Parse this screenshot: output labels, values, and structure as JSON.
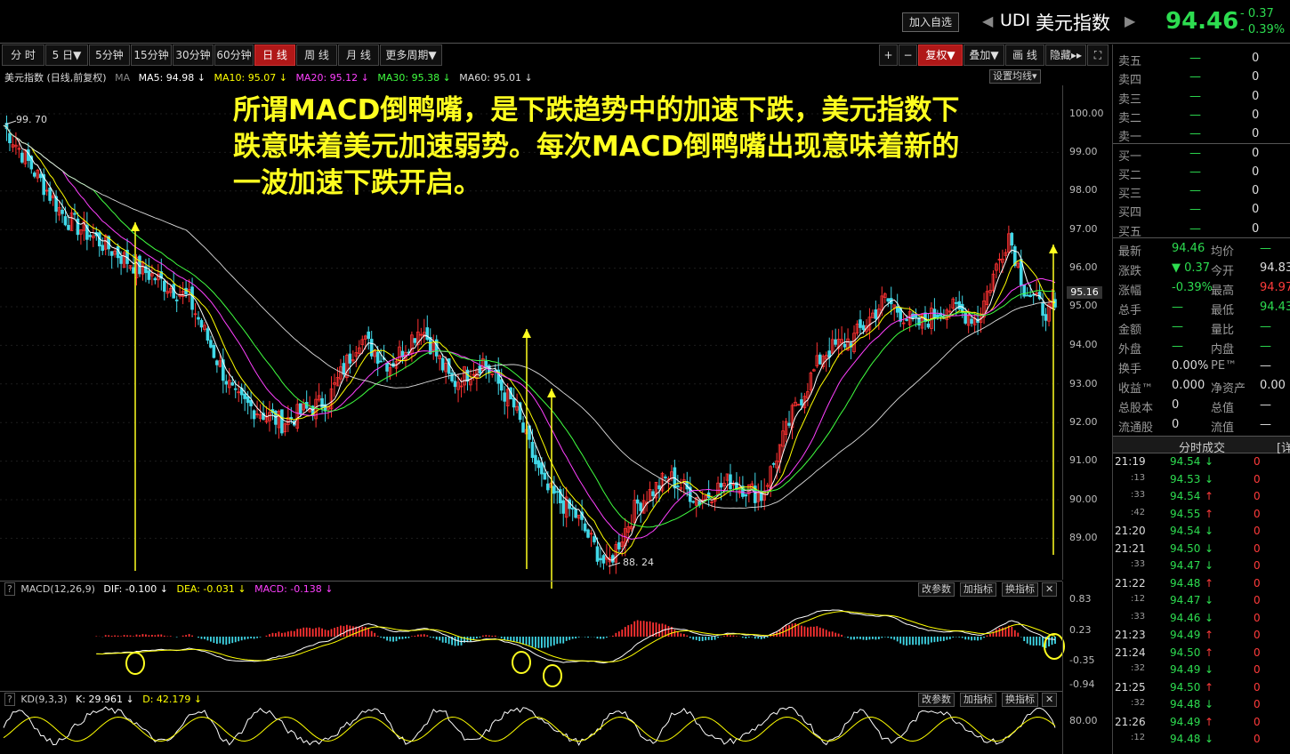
{
  "toolbar": {
    "add_watch": "加入自选",
    "code": "UDI",
    "name": "美元指数",
    "price": "94.46",
    "change": "- 0.37",
    "change_pct": "- 0.39%"
  },
  "tabs": [
    "分 时",
    "5 日▼",
    "5分钟",
    "15分钟",
    "30分钟",
    "60分钟",
    "日 线",
    "周 线",
    "月 线",
    "更多周期▼"
  ],
  "active_tab": "日 线",
  "right_tools": {
    "plus": "+",
    "minus": "−",
    "fuquan": "复权▼",
    "diejia": "叠加▼",
    "huaxian": "画 线",
    "yincang": "隐藏▸▸",
    "expand": "⛶"
  },
  "ma_header": {
    "title": "美元指数 (日线,前复权)",
    "ma_label": "MA",
    "ma5": "MA5: 94.98 ↓",
    "ma10": "MA10: 95.07 ↓",
    "ma20": "MA20: 95.12 ↓",
    "ma30": "MA30: 95.38 ↓",
    "ma60": "MA60: 95.01 ↓",
    "settings": "设置均线▾"
  },
  "price_axis": [
    "100.00",
    "99.00",
    "98.00",
    "97.00",
    "96.00",
    "95.00",
    "94.00",
    "93.00",
    "92.00",
    "91.00",
    "90.00",
    "89.00"
  ],
  "price_marker": "95.16",
  "extremes": {
    "high_label": "99. 70",
    "low_label": "88. 24"
  },
  "annotation": "所谓MACD倒鸭嘴，是下跌趋势中的加速下跌，美元指数下跌意味着美元加速弱势。每次MACD倒鸭嘴出现意味着新的一波加速下跌开启。",
  "macd_header": {
    "name": "MACD(12,26,9)",
    "dif": "DIF: -0.100 ↓",
    "dea": "DEA: -0.031 ↓",
    "macd": "MACD: -0.138 ↓"
  },
  "macd_axis": [
    "0.83",
    "0.23",
    "-0.35",
    "-0.94"
  ],
  "kd_header": {
    "name": "KD(9,3,3)",
    "k": "K: 29.961 ↓",
    "d": "D: 42.179 ↓"
  },
  "kd_axis": [
    "80.00"
  ],
  "panel_buttons": {
    "edit": "改参数",
    "add": "加指标",
    "swap": "换指标",
    "close": "✕"
  },
  "quote": {
    "book": [
      {
        "label": "卖五",
        "price": "—",
        "vol": "0"
      },
      {
        "label": "卖四",
        "price": "—",
        "vol": "0"
      },
      {
        "label": "卖三",
        "price": "—",
        "vol": "0"
      },
      {
        "label": "卖二",
        "price": "—",
        "vol": "0"
      },
      {
        "label": "卖一",
        "price": "—",
        "vol": "0"
      },
      {
        "label": "买一",
        "price": "—",
        "vol": "0"
      },
      {
        "label": "买二",
        "price": "—",
        "vol": "0"
      },
      {
        "label": "买三",
        "price": "—",
        "vol": "0"
      },
      {
        "label": "买四",
        "price": "—",
        "vol": "0"
      },
      {
        "label": "买五",
        "price": "—",
        "vol": "0"
      }
    ],
    "stats": [
      {
        "l1": "最新",
        "v1": "94.46",
        "c1": "green",
        "l2": "均价",
        "v2": "—",
        "c2": "green"
      },
      {
        "l1": "涨跌",
        "v1": "▼ 0.37",
        "c1": "green",
        "l2": "今开",
        "v2": "94.83",
        "c2": "white"
      },
      {
        "l1": "涨幅",
        "v1": "-0.39%",
        "c1": "green",
        "l2": "最高",
        "v2": "94.97",
        "c2": "red"
      },
      {
        "l1": "总手",
        "v1": "—",
        "c1": "green",
        "l2": "最低",
        "v2": "94.43",
        "c2": "green"
      },
      {
        "l1": "金额",
        "v1": "—",
        "c1": "green",
        "l2": "量比",
        "v2": "—",
        "c2": "green"
      },
      {
        "l1": "外盘",
        "v1": "—",
        "c1": "green",
        "l2": "内盘",
        "v2": "—",
        "c2": "green"
      },
      {
        "l1": "换手",
        "v1": "0.00%",
        "c1": "white",
        "l2": "PE™",
        "v2": "—",
        "c2": "white"
      },
      {
        "l1": "收益™",
        "v1": "0.000",
        "c1": "white",
        "l2": "净资产",
        "v2": "0.00",
        "c2": "white"
      },
      {
        "l1": "总股本",
        "v1": "0",
        "c1": "white",
        "l2": "总值",
        "v2": "—",
        "c2": "white"
      },
      {
        "l1": "流通股",
        "v1": "0",
        "c1": "white",
        "l2": "流值",
        "v2": "—",
        "c2": "white"
      }
    ],
    "trades_title": "分时成交",
    "trades_more": "[详",
    "trades": [
      {
        "t": "21:19",
        "p": "94.54",
        "d": "↓",
        "v": "0"
      },
      {
        "t": ":13",
        "p": "94.53",
        "d": "↓",
        "v": "0"
      },
      {
        "t": ":33",
        "p": "94.54",
        "d": "↑",
        "v": "0"
      },
      {
        "t": ":42",
        "p": "94.55",
        "d": "↑",
        "v": "0"
      },
      {
        "t": "21:20",
        "p": "94.54",
        "d": "↓",
        "v": "0"
      },
      {
        "t": "21:21",
        "p": "94.50",
        "d": "↓",
        "v": "0"
      },
      {
        "t": ":33",
        "p": "94.47",
        "d": "↓",
        "v": "0"
      },
      {
        "t": "21:22",
        "p": "94.48",
        "d": "↑",
        "v": "0"
      },
      {
        "t": ":12",
        "p": "94.47",
        "d": "↓",
        "v": "0"
      },
      {
        "t": ":33",
        "p": "94.46",
        "d": "↓",
        "v": "0"
      },
      {
        "t": "21:23",
        "p": "94.49",
        "d": "↑",
        "v": "0"
      },
      {
        "t": "21:24",
        "p": "94.50",
        "d": "↑",
        "v": "0"
      },
      {
        "t": ":32",
        "p": "94.49",
        "d": "↓",
        "v": "0"
      },
      {
        "t": "21:25",
        "p": "94.50",
        "d": "↑",
        "v": "0"
      },
      {
        "t": ":32",
        "p": "94.48",
        "d": "↓",
        "v": "0"
      },
      {
        "t": "21:26",
        "p": "94.49",
        "d": "↑",
        "v": "0"
      },
      {
        "t": ":12",
        "p": "94.48",
        "d": "↓",
        "v": "0"
      }
    ]
  },
  "colors": {
    "ma5": "#ffffff",
    "ma10": "#ffff00",
    "ma20": "#ff40ff",
    "ma30": "#40ff40",
    "ma60": "#dddddd",
    "up": "#ff3232",
    "down": "#40d8e8",
    "annotation": "#ffff20"
  },
  "chart_data": {
    "type": "candlestick",
    "series_path": [
      [
        0,
        99.7
      ],
      [
        20,
        97.3
      ],
      [
        40,
        96.2
      ],
      [
        60,
        95.2
      ],
      [
        75,
        92.6
      ],
      [
        90,
        92.0
      ],
      [
        105,
        92.6
      ],
      [
        115,
        94.2
      ],
      [
        125,
        93.5
      ],
      [
        135,
        94.5
      ],
      [
        145,
        93.0
      ],
      [
        155,
        93.6
      ],
      [
        165,
        92.4
      ],
      [
        175,
        90.3
      ],
      [
        185,
        89.6
      ],
      [
        195,
        88.24
      ],
      [
        205,
        89.9
      ],
      [
        215,
        90.6
      ],
      [
        225,
        90.0
      ],
      [
        235,
        90.5
      ],
      [
        245,
        90.1
      ],
      [
        255,
        92.2
      ],
      [
        265,
        93.8
      ],
      [
        275,
        94.2
      ],
      [
        285,
        95.2
      ],
      [
        295,
        94.5
      ],
      [
        305,
        95.0
      ],
      [
        315,
        94.7
      ],
      [
        325,
        96.9
      ],
      [
        330,
        95.5
      ],
      [
        335,
        95.0
      ],
      [
        340,
        94.8
      ]
    ]
  }
}
